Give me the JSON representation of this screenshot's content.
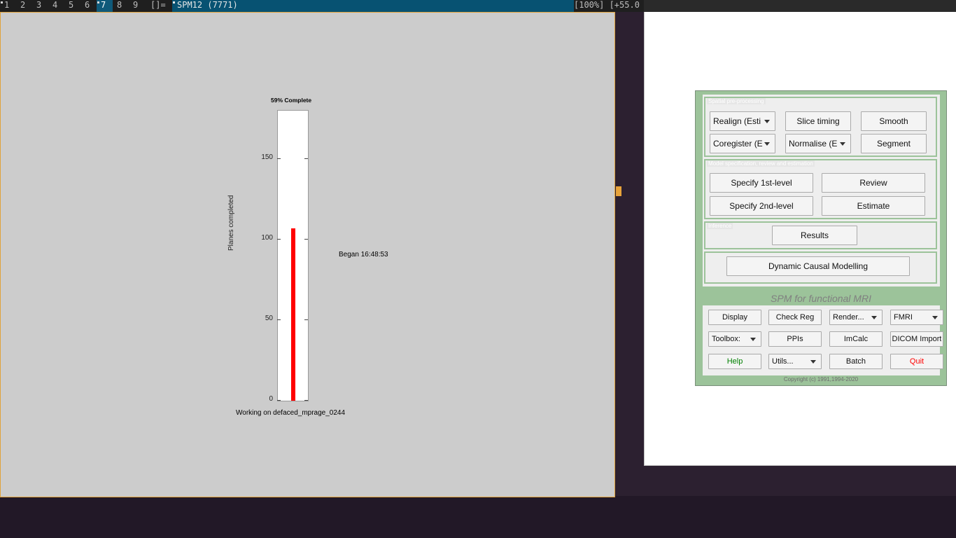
{
  "topbar": {
    "workspaces": [
      "1",
      "2",
      "3",
      "4",
      "5",
      "6",
      "7",
      "8",
      "9"
    ],
    "active_workspace": "7",
    "layout_indicator": "[]=",
    "window_title": "SPM12 (7771)",
    "status": "[100%] [+55.0"
  },
  "progress": {
    "title": "59% Complete",
    "ylabel": "Planes completed",
    "ticks": [
      "0",
      "50",
      "100",
      "150"
    ],
    "began": "Began 16:48:53",
    "working_on": "Working on defaced_mprage_0244",
    "chart_data": {
      "type": "bar",
      "categories": [
        ""
      ],
      "values": [
        107
      ],
      "ylim": [
        0,
        180
      ],
      "bar_color": "#ff0000",
      "yticks": [
        0,
        50,
        100,
        150
      ]
    }
  },
  "spm": {
    "sections": {
      "spatial": "Spatial pre-processing",
      "model": "Model specification, review and estimation",
      "inference": "Inference"
    },
    "buttons": {
      "realign": "Realign (Esti",
      "slice_timing": "Slice timing",
      "smooth": "Smooth",
      "coregister": "Coregister (E",
      "normalise": "Normalise (E",
      "segment": "Segment",
      "specify_1st": "Specify 1st-level",
      "review": "Review",
      "specify_2nd": "Specify 2nd-level",
      "estimate": "Estimate",
      "results": "Results",
      "dcm": "Dynamic Causal Modelling",
      "display": "Display",
      "check_reg": "Check Reg",
      "render": "Render...",
      "fmri": "FMRI",
      "toolbox": "Toolbox:",
      "ppis": "PPIs",
      "imcalc": "ImCalc",
      "dicom": "DICOM Import",
      "help": "Help",
      "utils": "Utils...",
      "batch": "Batch",
      "quit": "Quit"
    },
    "subtitle": "SPM for functional MRI",
    "copyright": "Copyright (c) 1991,1994-2020",
    "colors": {
      "help": "#008000",
      "quit": "#ff0000",
      "panel": "#9cc39a"
    }
  }
}
